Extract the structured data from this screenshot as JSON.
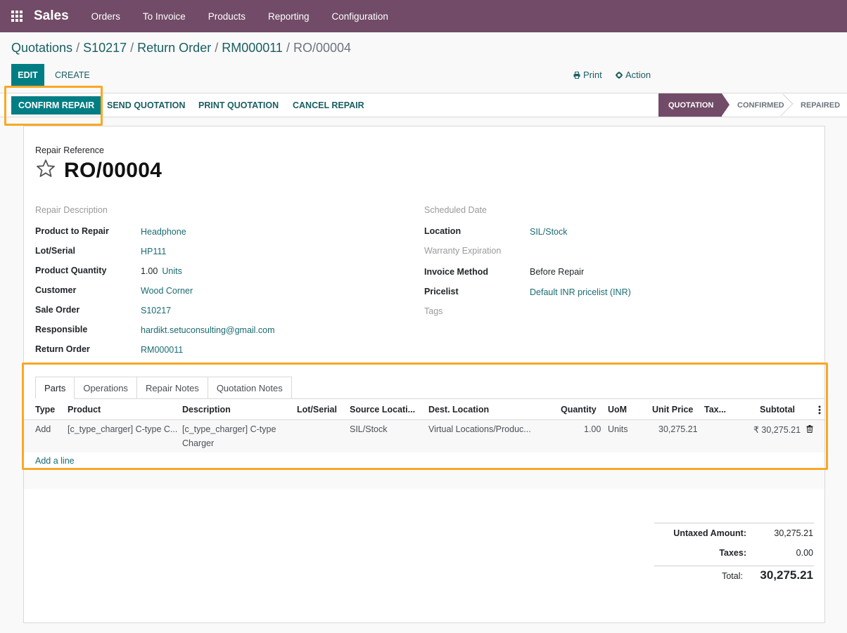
{
  "navbar": {
    "app_name": "Sales",
    "menu": [
      "Orders",
      "To Invoice",
      "Products",
      "Reporting",
      "Configuration"
    ]
  },
  "breadcrumb": {
    "items": [
      "Quotations",
      "S10217",
      "Return Order",
      "RM000011"
    ],
    "current": "RO/00004"
  },
  "controls": {
    "edit_label": "EDIT",
    "create_label": "CREATE",
    "print_label": "Print",
    "action_label": "Action"
  },
  "statusbar": {
    "buttons": [
      "CONFIRM REPAIR",
      "SEND QUOTATION",
      "PRINT QUOTATION",
      "CANCEL REPAIR"
    ],
    "stages": [
      "QUOTATION",
      "CONFIRMED",
      "REPAIRED"
    ],
    "active_stage": "QUOTATION"
  },
  "form": {
    "ref_label": "Repair Reference",
    "ref_value": "RO/00004",
    "left": {
      "repair_description": "Repair Description",
      "product_to_repair_label": "Product to Repair",
      "product_to_repair": "Headphone",
      "lot_serial_label": "Lot/Serial",
      "lot_serial": "HP111",
      "product_qty_label": "Product Quantity",
      "product_qty": "1.00",
      "product_uom": "Units",
      "customer_label": "Customer",
      "customer": "Wood Corner",
      "sale_order_label": "Sale Order",
      "sale_order": "S10217",
      "responsible_label": "Responsible",
      "responsible": "hardikt.setuconsulting@gmail.com",
      "return_order_label": "Return Order",
      "return_order": "RM000011"
    },
    "right": {
      "scheduled_date_label": "Scheduled Date",
      "location_label": "Location",
      "location": "SIL/Stock",
      "warranty_label": "Warranty Expiration",
      "invoice_method_label": "Invoice Method",
      "invoice_method": "Before Repair",
      "pricelist_label": "Pricelist",
      "pricelist": "Default INR pricelist (INR)",
      "tags_label": "Tags"
    }
  },
  "notebook": {
    "tabs": [
      "Parts",
      "Operations",
      "Repair Notes",
      "Quotation Notes"
    ],
    "columns": [
      "Type",
      "Product",
      "Description",
      "Lot/Serial",
      "Source Locati...",
      "Dest. Location",
      "Quantity",
      "UoM",
      "Unit Price",
      "Tax...",
      "Subtotal"
    ],
    "row": {
      "type": "Add",
      "product": "[c_type_charger] C-type C...",
      "description_1": "[c_type_charger] C-type",
      "description_2": "Charger",
      "lot_serial": "",
      "source": "SIL/Stock",
      "dest": "Virtual Locations/Produc...",
      "quantity": "1.00",
      "uom": "Units",
      "unit_price": "30,275.21",
      "tax": "",
      "subtotal": "₹ 30,275.21"
    },
    "add_line": "Add a line"
  },
  "totals": {
    "untaxed_label": "Untaxed Amount:",
    "untaxed": "30,275.21",
    "taxes_label": "Taxes:",
    "taxes": "0.00",
    "total_label": "Total:",
    "total": "30,275.21"
  },
  "icons": {
    "apps": "apps-grid-icon",
    "star": "star-outline-icon",
    "print": "printer-icon",
    "action": "gear-icon",
    "options": "vertical-dots-icon",
    "delete": "trash-icon"
  },
  "colors": {
    "brand": "#714b67",
    "primary": "#017e84",
    "highlight": "#f9a825"
  }
}
